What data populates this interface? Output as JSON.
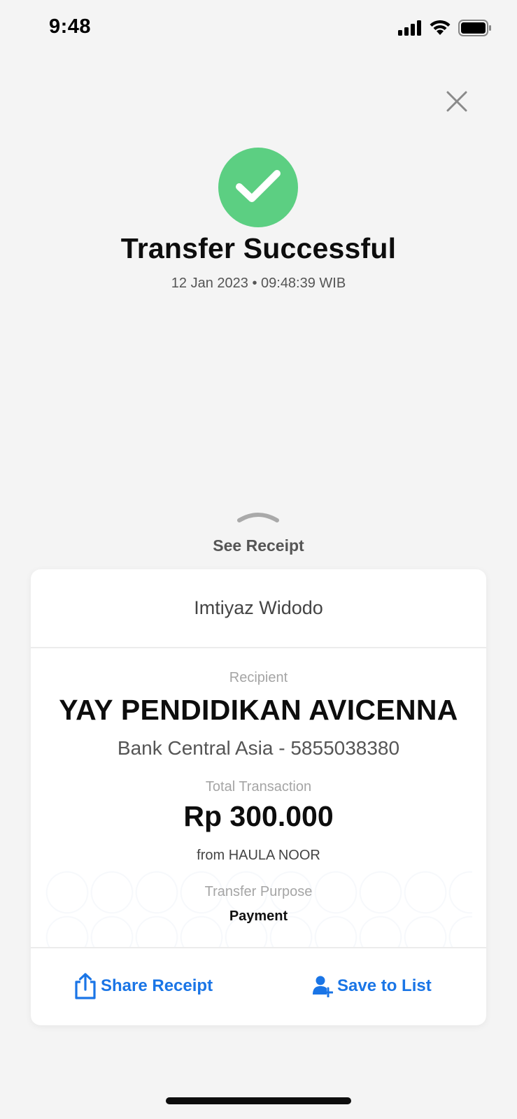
{
  "status_bar": {
    "time": "9:48",
    "icons": [
      "cellular-signal-icon",
      "wifi-icon",
      "battery-icon"
    ]
  },
  "header": {
    "close_icon": "close-icon"
  },
  "success": {
    "icon": "checkmark-icon",
    "icon_color": "#5ccf82",
    "title": "Transfer Successful",
    "datetime": "12 Jan 2023 • 09:48:39 WIB"
  },
  "see_receipt": {
    "chevron_icon": "chevron-up-icon",
    "label": "See Receipt"
  },
  "receipt": {
    "sender_name": "Imtiyaz Widodo",
    "recipient_label": "Recipient",
    "recipient_name": "YAY PENDIDIKAN AVICENNA",
    "recipient_bank": "Bank Central Asia - 5855038380",
    "total_label": "Total Transaction",
    "total_amount": "Rp 300.000",
    "from_text": "from HAULA NOOR",
    "purpose_label": "Transfer Purpose",
    "purpose_value": "Payment"
  },
  "actions": {
    "accent_color": "#1a75e6",
    "share": {
      "label": "Share Receipt",
      "icon": "share-icon"
    },
    "save": {
      "label": "Save to List",
      "icon": "add-contact-icon"
    }
  }
}
